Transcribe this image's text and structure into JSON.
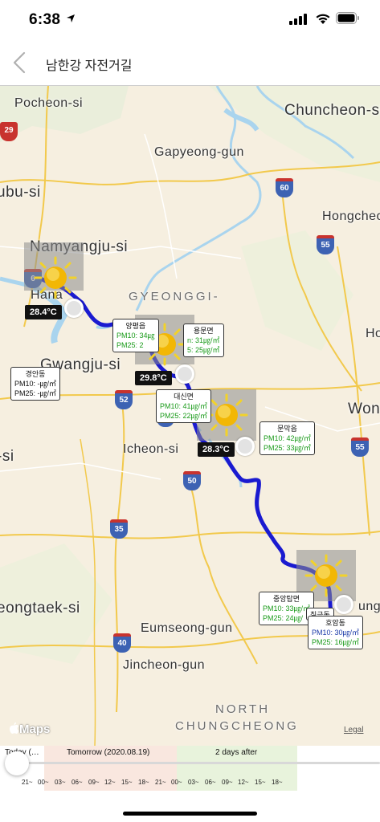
{
  "status_bar": {
    "time": "6:38"
  },
  "nav": {
    "title": "남한강 자전거길"
  },
  "map": {
    "cities": {
      "pocheon": "Pocheon-si",
      "chuncheon": "Chuncheon-si",
      "gapyeong": "Gapyeong-gun",
      "ubu": "ubu-si",
      "hongcheon": "Hongcheo",
      "namyangju": "Namyangju-si",
      "gyeonggi": "GYEONGGI-",
      "gwangju": "Gwangju-si",
      "hanam": "Hana",
      "won": "Won",
      "si": "-si",
      "icheon": "Icheon-si",
      "eongtaek": "eongtaek-si",
      "eumseong": "Eumseong-gun",
      "jincheon": "Jincheon-gun",
      "north": "NORTH",
      "chungcheong": "CHUNGCHEONG",
      "ho": "Ho",
      "ung": "ung"
    },
    "shields": [
      "29",
      "60",
      "55",
      "6",
      "52",
      "45",
      "50",
      "35",
      "40",
      "55"
    ],
    "temps": [
      "28.4°C",
      "29.8°C",
      "28.3°C"
    ],
    "pm_boxes": [
      {
        "name": "경안동",
        "pm10": "PM10: -㎍/㎥",
        "pm25": "PM25: -㎍/㎥"
      },
      {
        "name": "양평읍",
        "pm10": "PM10: 34㎍",
        "pm25": "PM25: 2"
      },
      {
        "name": "용문면",
        "pm10": "n: 31㎍/㎥",
        "pm25": "5: 25㎍/㎥"
      },
      {
        "name": "대신면",
        "pm10": "PM10: 41㎍/㎥",
        "pm25": "PM25: 22㎍/㎥"
      },
      {
        "name": "문막읍",
        "pm10": "PM10: 42㎍/㎥",
        "pm25": "PM25: 33㎍/㎥"
      },
      {
        "name": "중앙탑면",
        "pm10": "PM10: 33㎍/㎥",
        "pm25": "PM25: 24㎍/"
      },
      {
        "name": "칠금동",
        "pm10": "",
        "pm25": ""
      },
      {
        "name": "호암동",
        "pm10": "PM10: 30㎍/㎥",
        "pm25": "PM25: 16㎍/㎥"
      }
    ],
    "apple_maps": "Maps",
    "legal": "Legal"
  },
  "timeline": {
    "today": "Today (…",
    "tomorrow": "Tomorrow (2020.08.19)",
    "day_after": "2 days after",
    "ticks": [
      "21~",
      "00~",
      "03~",
      "06~",
      "09~",
      "12~",
      "15~",
      "18~",
      "21~",
      "00~",
      "03~",
      "06~",
      "09~",
      "12~",
      "15~",
      "18~"
    ],
    "colors": {
      "tomorrow": "#f9e7df",
      "day_after": "#e8f3dc"
    }
  },
  "colors": {
    "route": "#1a1ad0",
    "map_bg": "#f6efe0",
    "water": "#a9d4ee"
  }
}
